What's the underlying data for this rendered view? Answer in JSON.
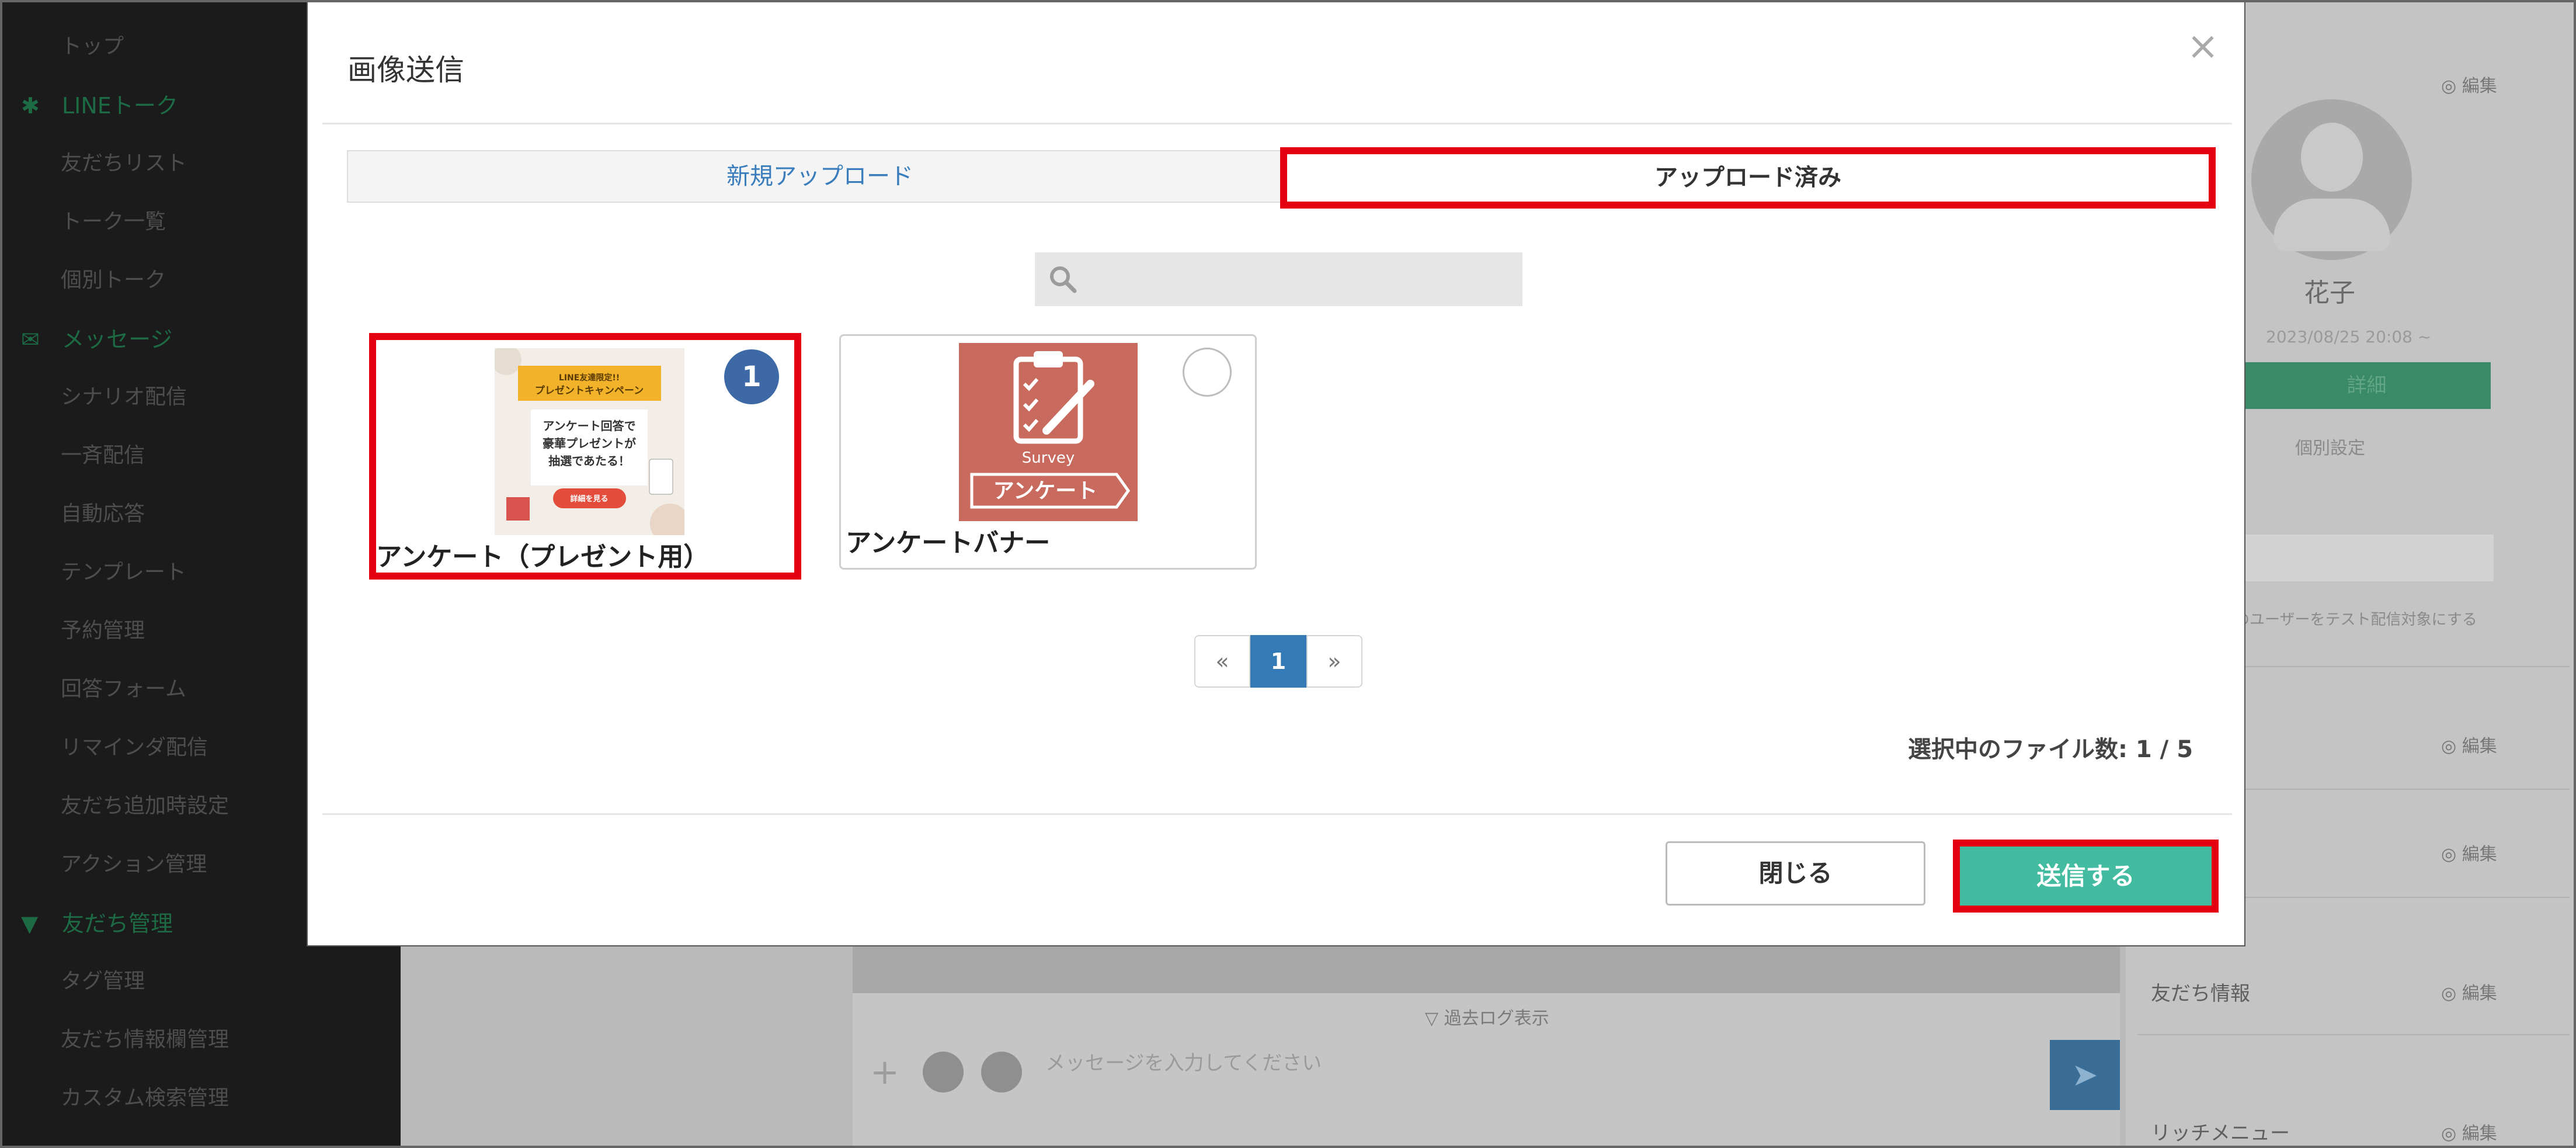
{
  "modal": {
    "title": "画像送信",
    "close_icon": "×",
    "tabs": [
      {
        "label": "新規アップロード",
        "active": false
      },
      {
        "label": "アップロード済み",
        "active": true
      }
    ],
    "search": {
      "placeholder": "",
      "value": ""
    },
    "images": [
      {
        "label": "アンケート（プレゼント用）",
        "selected": true,
        "selection_number": "1",
        "thumbnail": {
          "banner_line1": "LINE友達限定!!",
          "banner_line2": "プレゼントキャンペーン",
          "headline_line1": "アンケート回答で",
          "headline_line2": "豪華プレゼントが",
          "headline_line3": "抽選であたる！",
          "button": "詳細を見る"
        }
      },
      {
        "label": "アンケートバナー",
        "selected": false,
        "selection_number": "",
        "thumbnail": {
          "caption": "Survey",
          "ribbon": "アンケート"
        }
      }
    ],
    "pagination": {
      "prev": "«",
      "current": "1",
      "next": "»"
    },
    "file_count": "選択中のファイル数: 1 / 5",
    "close_button": "閉じる",
    "send_button": "送信する"
  },
  "colors": {
    "highlight_red": "#e50011",
    "send_green": "#43bba0",
    "link_blue": "#3a7dbd",
    "page_active": "#337ab7",
    "badge_blue": "#3d6aa6",
    "thumb1_bg": "#f2ede6",
    "thumb1_banner": "#f2b32b",
    "thumb2_bg": "#c96a5e"
  },
  "background_app": {
    "sidebar": {
      "items": [
        {
          "type": "item",
          "label": "トップ"
        },
        {
          "type": "group",
          "icon": "gear-icon",
          "label": "LINEトーク"
        },
        {
          "type": "item",
          "label": "友だちリスト"
        },
        {
          "type": "item",
          "label": "トーク一覧"
        },
        {
          "type": "item",
          "label": "個別トーク"
        },
        {
          "type": "group",
          "icon": "chat-icon",
          "label": "メッセージ"
        },
        {
          "type": "item",
          "label": "シナリオ配信"
        },
        {
          "type": "item",
          "label": "一斉配信"
        },
        {
          "type": "item",
          "label": "自動応答"
        },
        {
          "type": "item",
          "label": "テンプレート"
        },
        {
          "type": "item",
          "label": "予約管理"
        },
        {
          "type": "item",
          "label": "回答フォーム"
        },
        {
          "type": "item",
          "label": "リマインダ配信"
        },
        {
          "type": "item",
          "label": "友だち追加時設定"
        },
        {
          "type": "item",
          "label": "アクション管理"
        },
        {
          "type": "group",
          "icon": "filter-icon",
          "label": "友だち管理"
        },
        {
          "type": "item",
          "label": "タグ管理"
        },
        {
          "type": "item",
          "label": "友だち情報欄管理"
        },
        {
          "type": "item",
          "label": "カスタム検索管理"
        }
      ]
    },
    "chat": {
      "hint": "▽ 過去ログ表示",
      "input_placeholder": "メッセージを入力してください",
      "send_icon": "➤",
      "toolbar_icons": [
        "plus-icon",
        "emoji-icon",
        "sticker-icon"
      ]
    },
    "profile": {
      "edit_label": "◎ 編集",
      "name": "花子",
      "date": "2023/08/25 20:08 ~",
      "button": "詳細",
      "link": "個別設定",
      "select_hint": "このユーザーをテスト配信対象にする",
      "sections": [
        "◎ 編集",
        "◎ 編集",
        "友だち情報",
        "リッチメニュー"
      ]
    }
  }
}
